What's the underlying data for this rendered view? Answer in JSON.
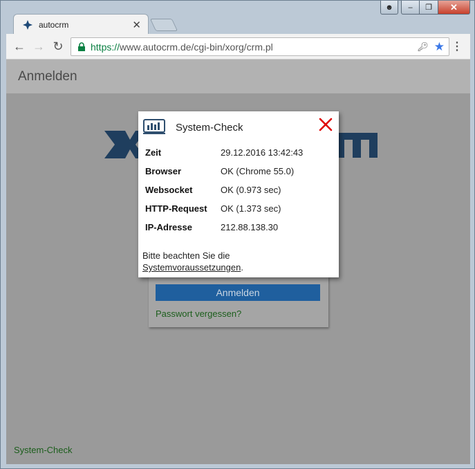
{
  "browser": {
    "tab_title": "autocrm",
    "url_secure": "https://",
    "url_host_path": "www.autocrm.de/cgi-bin/xorg/crm.pl"
  },
  "page": {
    "header_title": "Anmelden",
    "login_button": "Anmelden",
    "forgot_link": "Passwort vergessen?",
    "system_check_link": "System-Check"
  },
  "dialog": {
    "title": "System-Check",
    "rows": [
      {
        "label": "Zeit",
        "value": "29.12.2016 13:42:43"
      },
      {
        "label": "Browser",
        "value": "OK (Chrome 55.0)"
      },
      {
        "label": "Websocket",
        "value": "OK (0.973 sec)"
      },
      {
        "label": "HTTP-Request",
        "value": "OK (1.373 sec)"
      },
      {
        "label": "IP-Adresse",
        "value": "212.88.138.30"
      }
    ],
    "note_prefix": "Bitte beachten Sie die",
    "note_link": "Systemvoraussetzungen",
    "note_suffix": "."
  },
  "colors": {
    "brand_blue": "#1f4a78",
    "link_green": "#1c5e1c",
    "close_red": "#e00000"
  }
}
